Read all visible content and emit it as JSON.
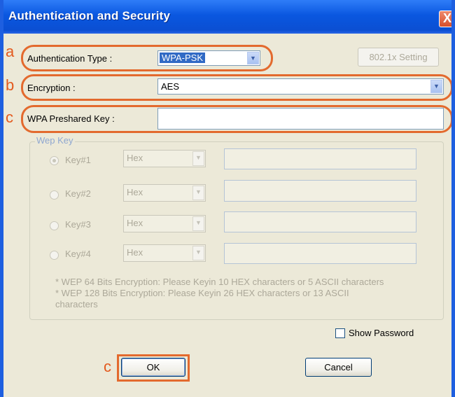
{
  "window": {
    "title": "Authentication and Security",
    "close_glyph": "X"
  },
  "annotations": {
    "a": "a",
    "b": "b",
    "c1": "c",
    "c2": "c"
  },
  "auth_type": {
    "label": "Authentication Type :",
    "value": "WPA-PSK"
  },
  "setting_button": {
    "label": "802.1x Setting"
  },
  "encryption": {
    "label": "Encryption :",
    "value": "AES"
  },
  "wpa_key": {
    "label": "WPA Preshared Key :",
    "value": ""
  },
  "wep": {
    "group_title": "Wep Key",
    "keys": [
      {
        "label": "Key#1",
        "format": "Hex",
        "selected": true,
        "value": ""
      },
      {
        "label": "Key#2",
        "format": "Hex",
        "selected": false,
        "value": ""
      },
      {
        "label": "Key#3",
        "format": "Hex",
        "selected": false,
        "value": ""
      },
      {
        "label": "Key#4",
        "format": "Hex",
        "selected": false,
        "value": ""
      }
    ],
    "note1": "* WEP 64 Bits Encryption:  Please Keyin 10 HEX characters or 5 ASCII characters",
    "note2": "* WEP 128 Bits Encryption:  Please Keyin 26 HEX characters or 13 ASCII",
    "note3": "characters"
  },
  "show_password": {
    "label": "Show Password",
    "checked": false
  },
  "buttons": {
    "ok": "OK",
    "cancel": "Cancel"
  },
  "icons": {
    "close": "close-icon",
    "dropdown": "chevron-down-icon"
  },
  "colors": {
    "titlebar": "#0a57e0",
    "annotation": "#e36a2e",
    "dialog_bg": "#ece9d8"
  }
}
